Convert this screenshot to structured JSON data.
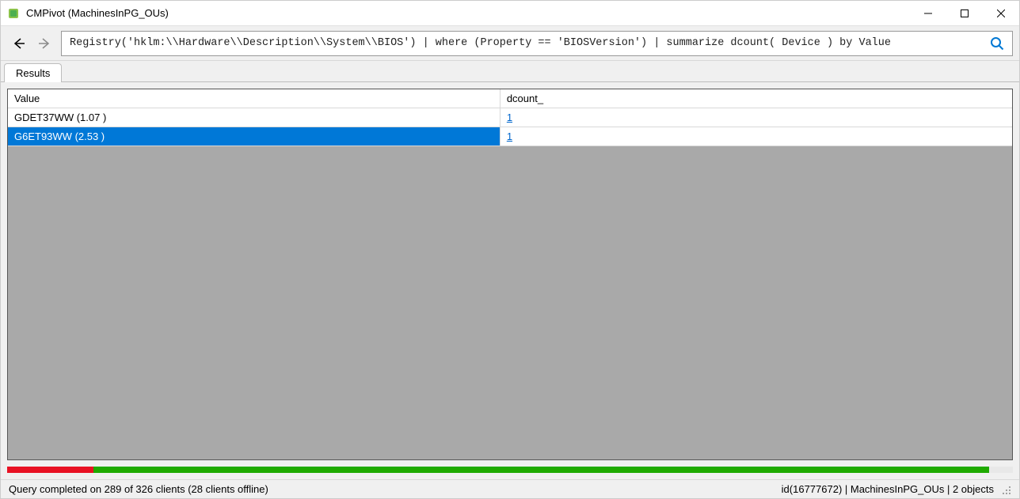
{
  "window": {
    "title": "CMPivot (MachinesInPG_OUs)"
  },
  "toolbar": {
    "query": "Registry('hklm:\\\\Hardware\\\\Description\\\\System\\\\BIOS') | where (Property == 'BIOSVersion') | summarize dcount( Device ) by Value"
  },
  "tabs": {
    "results_label": "Results"
  },
  "grid": {
    "columns": {
      "value": "Value",
      "dcount": "dcount_"
    },
    "rows": [
      {
        "value": "GDET37WW (1.07 )",
        "dcount": "1",
        "selected": false
      },
      {
        "value": "G6ET93WW (2.53 )",
        "dcount": "1",
        "selected": true
      }
    ]
  },
  "progress": {
    "red_percent": 8.6,
    "green_percent": 89.0
  },
  "status": {
    "left": "Query completed on 289 of 326 clients (28 clients offline)",
    "right": "id(16777672)  |  MachinesInPG_OUs  |  2 objects"
  }
}
